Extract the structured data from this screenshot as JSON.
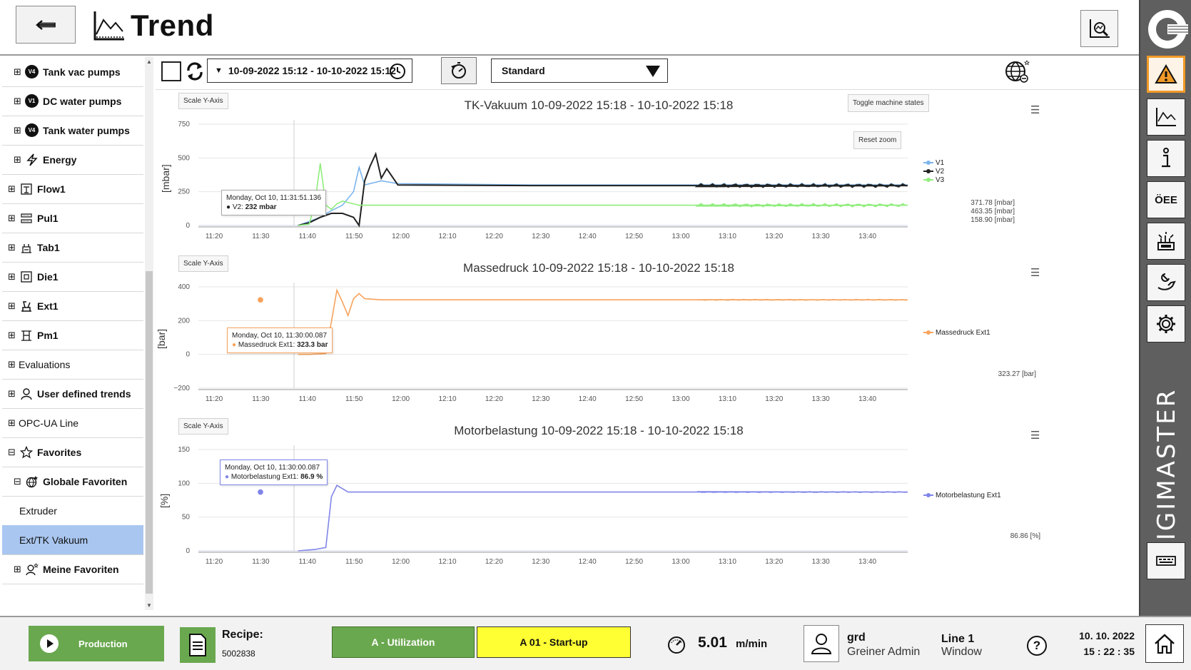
{
  "header": {
    "title": "Trend"
  },
  "sidebar": {
    "items": [
      {
        "label": "Tank vac pumps",
        "toggle": "⊞",
        "badge": "V4"
      },
      {
        "label": "DC water pumps",
        "toggle": "⊞",
        "badge": "V1"
      },
      {
        "label": "Tank water pumps",
        "toggle": "⊞",
        "badge": "V4"
      },
      {
        "label": "Energy",
        "toggle": "⊞"
      },
      {
        "label": "Flow1",
        "toggle": "⊞"
      },
      {
        "label": "Pul1",
        "toggle": "⊞"
      },
      {
        "label": "Tab1",
        "toggle": "⊞"
      },
      {
        "label": "Die1",
        "toggle": "⊞"
      },
      {
        "label": "Ext1",
        "toggle": "⊞"
      },
      {
        "label": "Pm1",
        "toggle": "⊞"
      },
      {
        "label": "Evaluations",
        "toggle": "⊞"
      },
      {
        "label": "User defined trends",
        "toggle": "⊞"
      },
      {
        "label": "OPC-UA Line",
        "toggle": "⊞"
      },
      {
        "label": "Favorites",
        "toggle": "⊟"
      },
      {
        "label": "Globale Favoriten",
        "toggle": "⊟"
      },
      {
        "label": "Extruder"
      },
      {
        "label": "Ext/TK Vakuum"
      },
      {
        "label": "Meine Favoriten",
        "toggle": "⊞"
      }
    ]
  },
  "toolbar": {
    "range": "10-09-2022 15:12 - 10-10-2022 15:12",
    "preset": "Standard"
  },
  "charts_common": {
    "scale_y_label": "Scale Y-Axis",
    "toggle_states_label": "Toggle machine states",
    "reset_zoom_label": "Reset zoom",
    "x_ticks": [
      "11:20",
      "11:30",
      "11:40",
      "11:50",
      "12:00",
      "12:10",
      "12:20",
      "12:30",
      "12:40",
      "12:50",
      "13:00",
      "13:10",
      "13:20",
      "13:30",
      "13:40"
    ]
  },
  "chart_data": [
    {
      "type": "line",
      "title": "TK-Vakuum 10-09-2022 15:18 - 10-10-2022 15:18",
      "ylabel": "[mbar]",
      "ylim": [
        0,
        750
      ],
      "y_ticks": [
        "750",
        "500",
        "250",
        "0"
      ],
      "series": [
        {
          "name": "V1",
          "color": "#7cb5ec",
          "x": [
            18,
            20,
            22,
            24,
            26,
            28,
            29,
            30,
            33,
            36,
            60,
            90,
            128
          ],
          "y": [
            0,
            30,
            60,
            110,
            150,
            250,
            430,
            300,
            330,
            310,
            300,
            300,
            300
          ]
        },
        {
          "name": "V2",
          "color": "#222222",
          "x": [
            18,
            20,
            22,
            24,
            26,
            28,
            29,
            30,
            31,
            32,
            33,
            34,
            36,
            60,
            90,
            128
          ],
          "y": [
            0,
            20,
            60,
            90,
            90,
            60,
            0,
            330,
            440,
            530,
            350,
            420,
            300,
            295,
            295,
            295
          ]
        },
        {
          "name": "V3",
          "color": "#90ed7d",
          "x": [
            18,
            20,
            21,
            22,
            23,
            24,
            25,
            26,
            29,
            33,
            36,
            60,
            90,
            128
          ],
          "y": [
            0,
            10,
            160,
            460,
            150,
            120,
            160,
            180,
            150,
            150,
            150,
            150,
            150,
            150
          ]
        }
      ],
      "readouts": [
        "371.78 [mbar]",
        "463.35 [mbar]",
        "158.90 [mbar]"
      ],
      "tooltip": {
        "time": "Monday, Oct 10, 11:31:51.136",
        "label": "V2:",
        "value": "232 mbar"
      }
    },
    {
      "type": "line",
      "title": "Massedruck 10-09-2022 15:18 - 10-10-2022 15:18",
      "ylabel": "[bar]",
      "ylim": [
        -200,
        400
      ],
      "y_ticks": [
        "400",
        "200",
        "0",
        "−200"
      ],
      "series": [
        {
          "name": "Massedruck Ext1",
          "color": "#f7a35c",
          "x": [
            18,
            20,
            23,
            25,
            26,
            27,
            28,
            29,
            30,
            33,
            36,
            60,
            90,
            128
          ],
          "y": [
            0,
            0,
            5,
            380,
            310,
            230,
            330,
            360,
            330,
            323,
            323,
            323,
            323,
            323
          ]
        }
      ],
      "readouts": [
        "323.27 [bar]"
      ],
      "tooltip": {
        "time": "Monday, Oct 10, 11:30:00.087",
        "label": "Massedruck Ext1:",
        "value": "323.3 bar"
      }
    },
    {
      "type": "line",
      "title": "Motorbelastung 10-09-2022 15:18 - 10-10-2022 15:18",
      "ylabel": "[%]",
      "ylim": [
        0,
        150
      ],
      "y_ticks": [
        "150",
        "100",
        "50",
        "0"
      ],
      "series": [
        {
          "name": "Motorbelastung Ext1",
          "color": "#8085e9",
          "x": [
            18,
            21,
            23,
            24,
            25,
            27,
            30,
            36,
            60,
            90,
            128
          ],
          "y": [
            0,
            2,
            5,
            80,
            97,
            87,
            87,
            87,
            87,
            87,
            87
          ]
        }
      ],
      "readouts": [
        "86.86 [%]"
      ],
      "tooltip": {
        "time": "Monday, Oct 10, 11:30:00.087",
        "label": "Motorbelastung Ext1:",
        "value": "86.9 %"
      }
    }
  ],
  "bottom": {
    "production_label": "Production",
    "recipe_label": "Recipe:",
    "recipe_value": "5002838",
    "utilization_label": "A - Utilization",
    "startup_label": "A 01 - Start-up",
    "speed_value": "5.01",
    "speed_unit": "m/min",
    "user_name": "grd",
    "user_role": "Greiner Admin",
    "line_name": "Line 1",
    "line_window": "Window",
    "date": "10. 10. 2022",
    "time": "15 : 22 : 35"
  },
  "rail": {
    "brand": "DIGIMASTER",
    "oee_label": "ÖEE"
  },
  "colors": {
    "accent_green": "#6aa84f",
    "status_yellow": "#ffff33",
    "alert_orange": "#f09a28",
    "selected_blue": "#a9c6f0"
  }
}
